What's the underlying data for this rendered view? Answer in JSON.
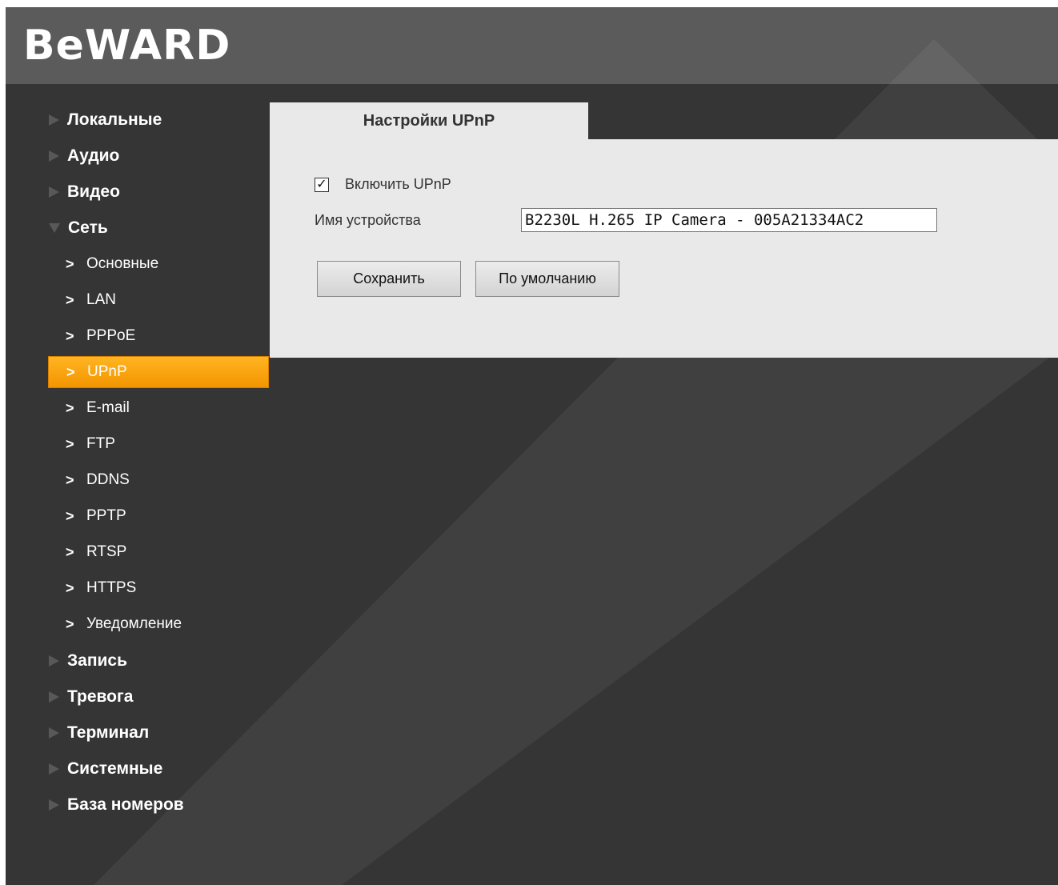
{
  "brand": {
    "logo_text": "BeWARD"
  },
  "sidebar": {
    "items": [
      {
        "label": "Локальные",
        "state": "collapsed"
      },
      {
        "label": "Аудио",
        "state": "collapsed"
      },
      {
        "label": "Видео",
        "state": "collapsed"
      },
      {
        "label": "Сеть",
        "state": "expanded"
      },
      {
        "label": "Запись",
        "state": "collapsed"
      },
      {
        "label": "Тревога",
        "state": "collapsed"
      },
      {
        "label": "Терминал",
        "state": "collapsed"
      },
      {
        "label": "Системные",
        "state": "collapsed"
      },
      {
        "label": "База номеров",
        "state": "collapsed"
      }
    ],
    "network_sub": [
      {
        "label": "Основные"
      },
      {
        "label": "LAN"
      },
      {
        "label": "PPPoE"
      },
      {
        "label": "UPnP",
        "active": true
      },
      {
        "label": "E-mail"
      },
      {
        "label": "FTP"
      },
      {
        "label": "DDNS"
      },
      {
        "label": "PPTP"
      },
      {
        "label": "RTSP"
      },
      {
        "label": "HTTPS"
      },
      {
        "label": "Уведомление"
      }
    ]
  },
  "main": {
    "tab_title": "Настройки UPnP",
    "enable_label": "Включить UPnP",
    "enable_checked": true,
    "device_name_label": "Имя устройства",
    "device_name_value": "B2230L H.265 IP Camera - 005A21334AC2",
    "save_label": "Сохранить",
    "default_label": "По умолчанию"
  },
  "colors": {
    "background": "#353535",
    "header": "#5b5b5b",
    "panel": "#e9e9e9",
    "active_item": "#f6a000"
  }
}
